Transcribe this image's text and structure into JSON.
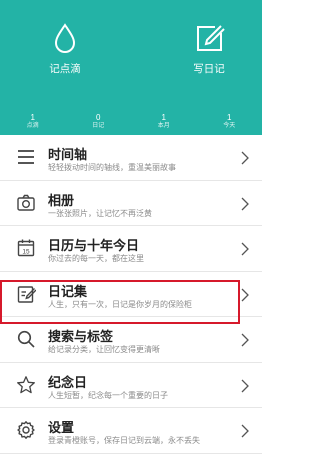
{
  "header": {
    "actions": [
      {
        "label": "记点滴",
        "icon": "droplet-icon"
      },
      {
        "label": "写日记",
        "icon": "edit-icon"
      }
    ],
    "stats": [
      {
        "value": "1",
        "caption": "点滴"
      },
      {
        "value": "0",
        "caption": "日记"
      },
      {
        "value": "1",
        "caption": "本月"
      },
      {
        "value": "1",
        "caption": "今天"
      }
    ],
    "background": "#23b3a6"
  },
  "menu": {
    "items": [
      {
        "title": "时间轴",
        "subtitle": "轻轻拨动时间的轴线，重温美丽故事",
        "icon": "timeline-icon"
      },
      {
        "title": "相册",
        "subtitle": "一张张照片，让记忆不再泛黄",
        "icon": "camera-icon"
      },
      {
        "title": "日历与十年今日",
        "subtitle": "你过去的每一天，都在这里",
        "icon": "calendar-icon",
        "icon_text": "15"
      },
      {
        "title": "日记集",
        "subtitle": "人生，只有一次，日记是你岁月的保险柜",
        "icon": "journal-icon"
      },
      {
        "title": "搜索与标签",
        "subtitle": "给记录分类，让回忆变得更清晰",
        "icon": "search-icon"
      },
      {
        "title": "纪念日",
        "subtitle": "人生短暂，纪念每一个重要的日子",
        "icon": "star-icon"
      },
      {
        "title": "设置",
        "subtitle": "登录青橙账号，保存日记到云端，永不丢失",
        "icon": "gear-icon"
      }
    ]
  },
  "colors": {
    "accent": "#23b3a6",
    "highlight": "#d6192b",
    "icon": "#444444"
  }
}
